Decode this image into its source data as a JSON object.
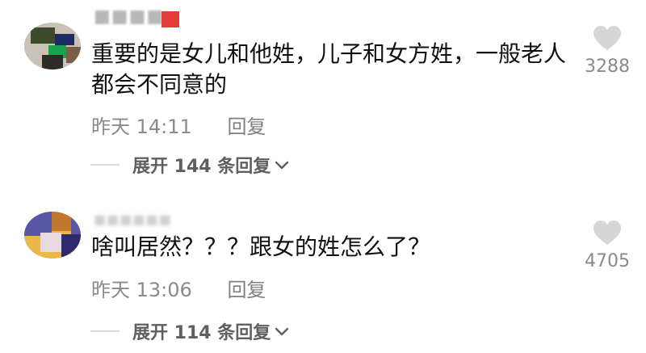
{
  "colors": {
    "text_primary": "#111111",
    "text_secondary": "#8a8a8a",
    "like_icon": "#d6d6d6",
    "badge_red": "#e43b3b"
  },
  "comments": [
    {
      "text": "重要的是女儿和他姓，儿子和女方姓，一般老人都会不同意的",
      "time": "昨天 14:11",
      "reply_label": "回复",
      "expand_label": "展开 144 条回复",
      "likes": "3288",
      "like_icon": "heart-icon"
    },
    {
      "text": "啥叫居然？？？跟女的姓怎么了？",
      "time": "昨天 13:06",
      "reply_label": "回复",
      "expand_label": "展开 114 条回复",
      "likes": "4705",
      "like_icon": "heart-icon"
    }
  ]
}
